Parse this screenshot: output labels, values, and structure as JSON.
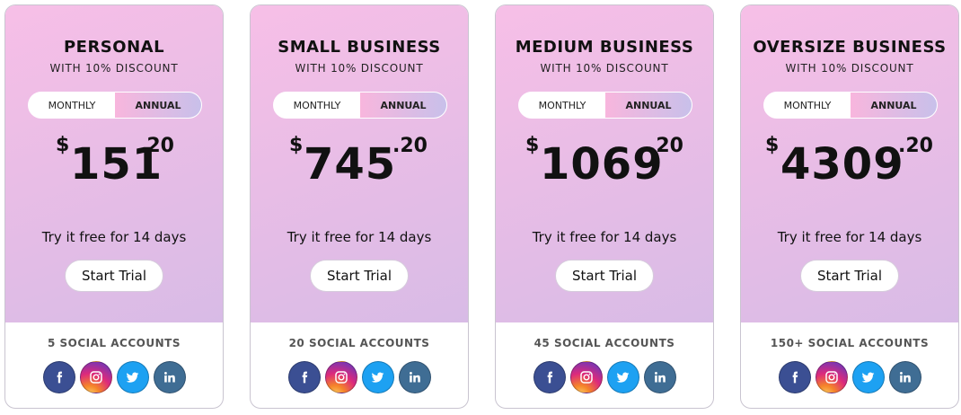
{
  "plans": [
    {
      "name": "PERSONAL",
      "discount": "WITH 10% DISCOUNT",
      "toggle": {
        "monthly": "MONTHLY",
        "annual": "ANNUAL"
      },
      "currency": "$",
      "price_whole": "151",
      "price_cents": ".20",
      "trial_text": "Try it free for 14 days",
      "cta": "Start Trial",
      "accounts": "5 SOCIAL ACCOUNTS"
    },
    {
      "name": "SMALL BUSINESS",
      "discount": "WITH 10% DISCOUNT",
      "toggle": {
        "monthly": "MONTHLY",
        "annual": "ANNUAL"
      },
      "currency": "$",
      "price_whole": "745",
      "price_cents": ".20",
      "trial_text": "Try it free for 14 days",
      "cta": "Start Trial",
      "accounts": "20 SOCIAL ACCOUNTS"
    },
    {
      "name": "MEDIUM BUSINESS",
      "discount": "WITH 10% DISCOUNT",
      "toggle": {
        "monthly": "MONTHLY",
        "annual": "ANNUAL"
      },
      "currency": "$",
      "price_whole": "1069",
      "price_cents": ".20",
      "trial_text": "Try it free for 14 days",
      "cta": "Start Trial",
      "accounts": "45 SOCIAL ACCOUNTS"
    },
    {
      "name": "OVERSIZE BUSINESS",
      "discount": "WITH 10% DISCOUNT",
      "toggle": {
        "monthly": "MONTHLY",
        "annual": "ANNUAL"
      },
      "currency": "$",
      "price_whole": "4309",
      "price_cents": ".20",
      "trial_text": "Try it free for 14 days",
      "cta": "Start Trial",
      "accounts": "150+ SOCIAL ACCOUNTS"
    }
  ],
  "selected_billing": "annual",
  "social_icons": [
    "facebook-icon",
    "instagram-icon",
    "twitter-icon",
    "linkedin-icon"
  ],
  "colors": {
    "card_gradient_start": "#f7bfe7",
    "card_gradient_end": "#d8bbe6",
    "toggle_active_start": "#f8b6dd",
    "toggle_active_end": "#c8c0ea",
    "facebook": "#3b4f93",
    "twitter": "#1da1f2",
    "linkedin": "#3f6d94",
    "accounts_text": "#555555"
  }
}
